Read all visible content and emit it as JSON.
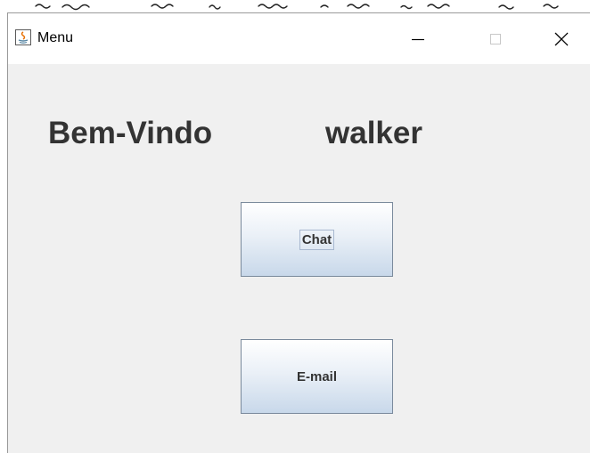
{
  "window": {
    "title": "Menu",
    "controls": {
      "minimize": "minimize-icon",
      "maximize": "maximize-icon",
      "close": "close-icon"
    }
  },
  "main": {
    "welcome_text": "Bem-Vindo",
    "username": "walker",
    "buttons": {
      "chat_label": "Chat",
      "email_label": "E-mail"
    }
  },
  "colors": {
    "window_bg": "#f0f0f0",
    "titlebar_bg": "#ffffff",
    "text": "#333333",
    "button_border": "#7a8a9c"
  }
}
